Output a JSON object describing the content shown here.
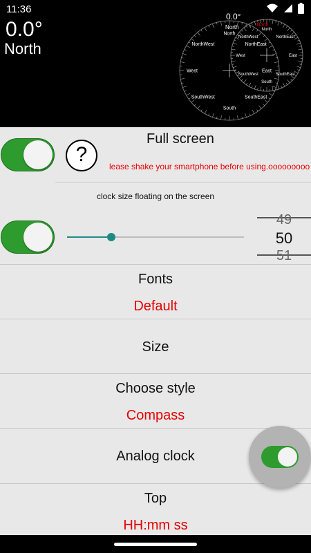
{
  "status_bar": {
    "time": "11:36",
    "icons": [
      "wifi-icon",
      "signal-icon",
      "battery-icon"
    ]
  },
  "header": {
    "degree": "0.0°",
    "direction": "North"
  },
  "compass_widget": {
    "small_degree": "0.0°",
    "small_direction": "North",
    "red_label": "North",
    "outer_labels": [
      "North",
      "NorthEast",
      "East",
      "SouthEast",
      "South",
      "SouthWest",
      "West",
      "NorthWest"
    ],
    "inner_labels": [
      "North",
      "NorthEast",
      "East",
      "SouthEast",
      "South",
      "SouthWest",
      "West",
      "NorthWest"
    ]
  },
  "settings": {
    "full_screen": {
      "label": "Full screen",
      "hint": "lease shake your smartphone before using.ooooooooo",
      "help_icon": "?",
      "enabled": true
    },
    "clock_size": {
      "label": "clock size floating on the screen",
      "enabled": true,
      "slider_fraction": 0.25,
      "picker_prev": "49",
      "picker_value": "50",
      "picker_next": "51"
    },
    "fonts": {
      "label": "Fonts",
      "value": "Default"
    },
    "size": {
      "label": "Size"
    },
    "style": {
      "label": "Choose style",
      "value": "Compass"
    },
    "analog_clock": {
      "label": "Analog clock",
      "enabled": true
    },
    "top": {
      "label": "Top",
      "value": "HH:mm ss"
    }
  },
  "colors": {
    "accent_red": "#e50000",
    "toggle_green": "#2e9b2e",
    "slider_teal": "#1e8a86"
  }
}
